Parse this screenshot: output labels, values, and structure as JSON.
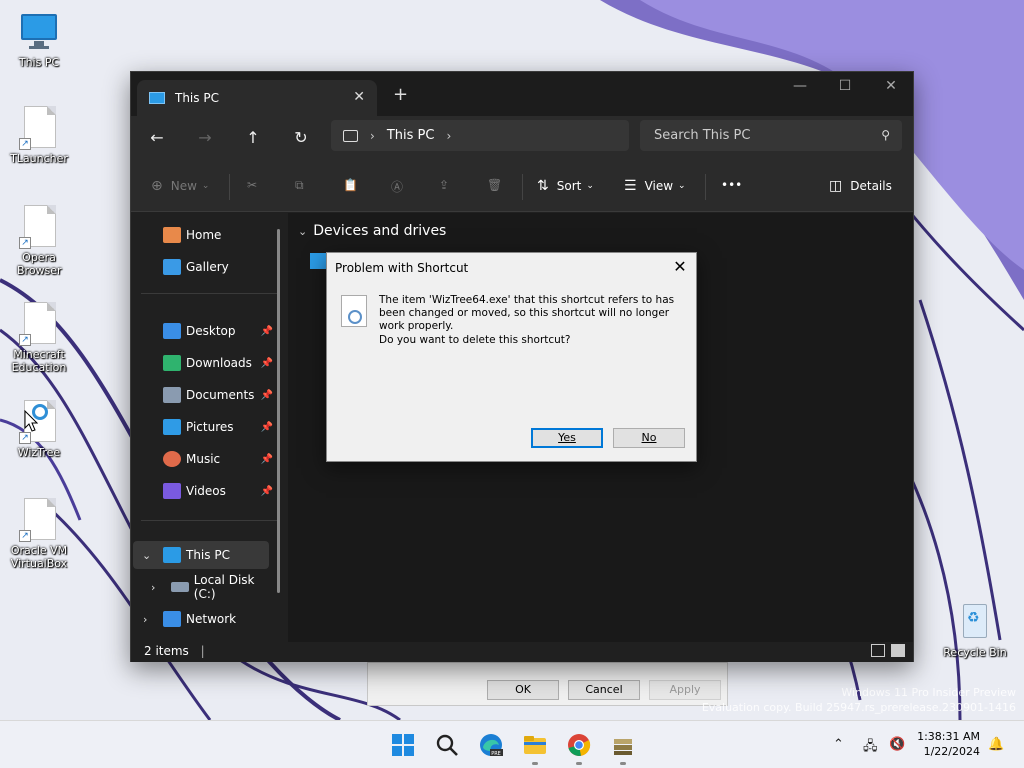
{
  "desktop": {
    "icons": [
      {
        "label": "This PC",
        "type": "pc"
      },
      {
        "label": "TLauncher",
        "type": "shortcut"
      },
      {
        "label": "Opera Browser",
        "type": "shortcut"
      },
      {
        "label": "Minecraft Education",
        "type": "shortcut"
      },
      {
        "label": "WizTree",
        "type": "wiztree"
      },
      {
        "label": "Oracle VM VirtualBox",
        "type": "shortcut"
      }
    ],
    "recycle_bin": "Recycle Bin",
    "watermark_line1": "Windows 11 Pro Insider Preview",
    "watermark_line2": "Evaluation copy. Build 25947.rs_prerelease.230901-1416"
  },
  "explorer": {
    "tab_title": "This PC",
    "breadcrumb": [
      "This PC"
    ],
    "search_placeholder": "Search This PC",
    "toolbar": {
      "new_label": "New",
      "sort_label": "Sort",
      "view_label": "View",
      "more_label": "•••",
      "details_label": "Details"
    },
    "sidebar": {
      "home": "Home",
      "gallery": "Gallery",
      "quick_access": [
        {
          "label": "Desktop",
          "color": "#3a8ee6"
        },
        {
          "label": "Downloads",
          "color": "#2fb36e"
        },
        {
          "label": "Documents",
          "color": "#8a9bb0"
        },
        {
          "label": "Pictures",
          "color": "#2f9be6"
        },
        {
          "label": "Music",
          "color": "#e06a4a"
        },
        {
          "label": "Videos",
          "color": "#7a5ae0"
        }
      ],
      "this_pc": "This PC",
      "local_disk": "Local Disk (C:)",
      "network": "Network"
    },
    "group_header": "Devices and drives",
    "status": "2 items"
  },
  "dialog": {
    "title": "Problem with Shortcut",
    "message": "The item 'WizTree64.exe' that this shortcut refers to has been changed or moved, so this shortcut will no longer work properly.",
    "question": "Do you want to delete this shortcut?",
    "yes_label": "Yes",
    "no_label": "No"
  },
  "properties": {
    "ok_label": "OK",
    "cancel_label": "Cancel",
    "apply_label": "Apply"
  },
  "taskbar": {
    "time": "1:38:31 AM",
    "date": "1/22/2024"
  }
}
